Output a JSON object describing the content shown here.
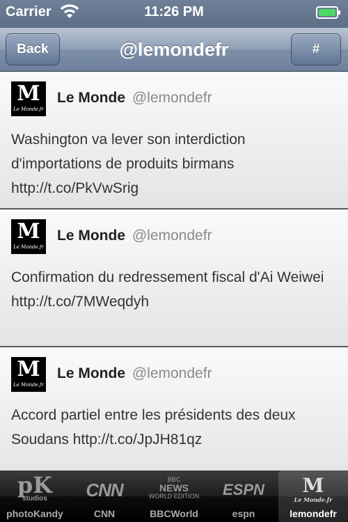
{
  "status": {
    "carrier": "Carrier",
    "time": "11:26 PM"
  },
  "nav": {
    "back_label": "Back",
    "title": "@lemondefr",
    "hash_label": "#"
  },
  "tweets": [
    {
      "name": "Le Monde",
      "handle": "@lemondefr",
      "text": "Washington va lever son interdiction d'importations de produits birmans http://t.co/PkVwSrig"
    },
    {
      "name": "Le Monde",
      "handle": "@lemondefr",
      "text": "Confirmation du redressement fiscal d'Ai Weiwei http://t.co/7MWeqdyh"
    },
    {
      "name": "Le Monde",
      "handle": "@lemondefr",
      "text": "Accord partiel entre les présidents des deux Soudans http://t.co/JpJH81qz"
    }
  ],
  "avatar": {
    "mark": "M",
    "caption": "Le Monde.fr"
  },
  "tabs": [
    {
      "label": "photoKandy",
      "icon": "photokandy-logo-icon",
      "logo": "pK",
      "logo_sub": "studios"
    },
    {
      "label": "CNN",
      "icon": "cnn-logo-icon",
      "logo": "CNN"
    },
    {
      "label": "BBCWorld",
      "icon": "bbc-logo-icon",
      "logo_top": "BBC",
      "logo": "NEWS",
      "logo_sub": "WORLD EDITION"
    },
    {
      "label": "espn",
      "icon": "espn-logo-icon",
      "logo": "ESPN"
    },
    {
      "label": "lemondefr",
      "icon": "lemonde-logo-icon",
      "logo": "M",
      "logo_sub": "Le Monde.fr",
      "active": true
    }
  ],
  "colors": {
    "nav_bar": "#8e9fb5",
    "status_bar": "#6f8098",
    "tab_bar": "#000000"
  }
}
